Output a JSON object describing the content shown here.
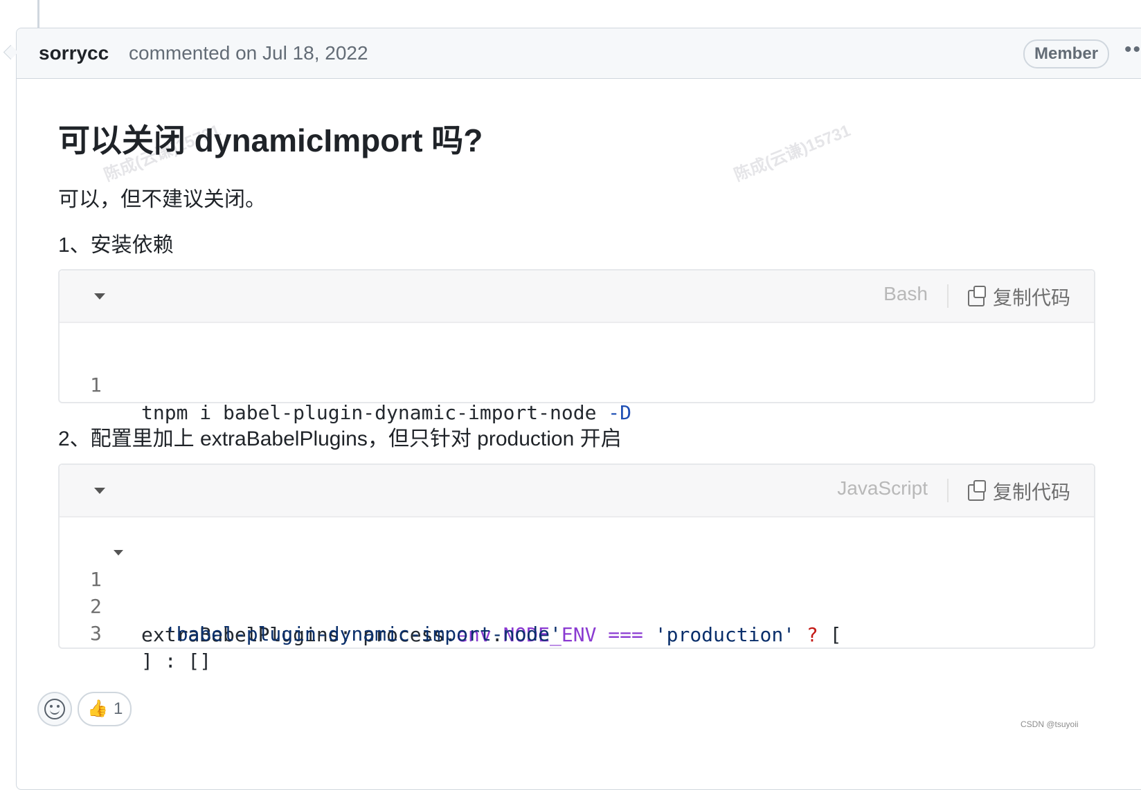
{
  "comment": {
    "author": "sorrycc",
    "meta": "commented on Jul 18, 2022",
    "badge": "Member",
    "more_icon": "more-horizontal-icon"
  },
  "body": {
    "title": "可以关闭 dynamicImport 吗?",
    "p1": "可以，但不建议关闭。",
    "p2": "1、安装依赖",
    "p3": "2、配置里加上 extraBabelPlugins，但只针对 production 开启"
  },
  "code1": {
    "lang": "Bash",
    "copy_label": "复制代码",
    "line_numbers": [
      "1"
    ],
    "line1_main": "tnpm i babel-plugin-dynamic-import-node ",
    "line1_flag": "-D"
  },
  "code2": {
    "lang": "JavaScript",
    "copy_label": "复制代码",
    "line_numbers": [
      "1",
      "2",
      "3"
    ],
    "line1_a": "extraBabelPlugins: process.",
    "line1_env": "env",
    "line1_dot": ".",
    "line1_node_env": "NODE_ENV",
    "line1_eq": " === ",
    "line1_str": "'production'",
    "line1_q": " ? ",
    "line1_open": "[",
    "line2_str": "  'babel-plugin-dynamic-import-node'",
    "line3": "] : []"
  },
  "watermarks": [
    "陈成(云谦)15731",
    "陈成(云谦)15731"
  ],
  "reactions": {
    "thumbs_up_count": "1"
  },
  "footer": {
    "csdn": "CSDN @tsuyoii"
  }
}
